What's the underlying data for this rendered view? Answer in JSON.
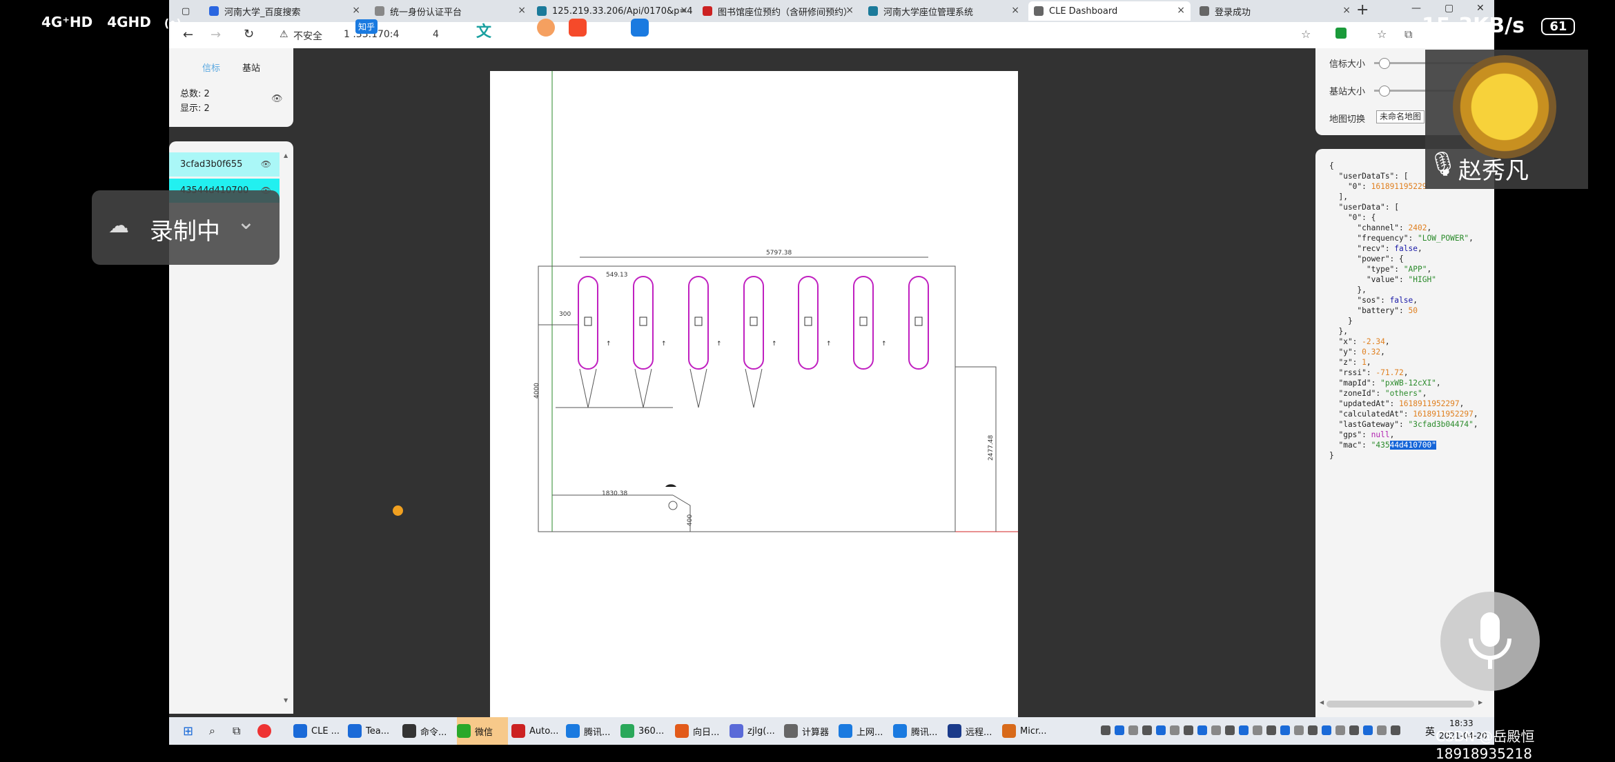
{
  "phone_status": {
    "signal1": "4G⁺HD",
    "signal2": "4GHD",
    "hotspot": "(•)",
    "net_speed": "15.3KB/s",
    "battery": "61"
  },
  "recording_overlay": {
    "label": "录制中",
    "chevron": "⌄"
  },
  "call": {
    "caller_name": "赵秀凡"
  },
  "watermark": "CSDN @岳殿恒18918935218",
  "browser": {
    "tabs": [
      {
        "label": "河南大学_百度搜索",
        "color": "#2a66e0"
      },
      {
        "label": "统一身份认证平台",
        "color": "#888"
      },
      {
        "label": "125.219.33.206/Api/0170&p=4",
        "color": "#1b7a9a"
      },
      {
        "label": "图书馆座位预约（含研修间预约）",
        "color": "#c22"
      },
      {
        "label": "河南大学座位管理系统",
        "color": "#1b7a9a"
      },
      {
        "label": "CLE Dashboard",
        "color": "#666"
      },
      {
        "label": "登录成功",
        "color": "#666"
      }
    ],
    "new_tab": "+",
    "window_controls": [
      "—",
      "▢",
      "✕"
    ],
    "address": {
      "security": "不安全",
      "url": "1 .33.170:4",
      "extra": "4"
    },
    "overlay_icons": [
      "知乎",
      "文"
    ]
  },
  "left_panel": {
    "tabs": [
      "信标",
      "基站"
    ],
    "total_label": "总数: 2",
    "shown_label": "显示: 2",
    "devices": [
      "3cfad3b0f655",
      "43544d410700"
    ]
  },
  "right_panel": {
    "beacon_size_label": "信标大小",
    "station_size_label": "基站大小",
    "map_switch_label": "地图切换",
    "map_select_value": "未命名地图"
  },
  "json_view": {
    "lines": [
      [
        [
          "jk",
          "{"
        ]
      ],
      [
        [
          "jk",
          "  \"userDataTs\": ["
        ]
      ],
      [
        [
          "jk",
          "    \"0\": "
        ],
        [
          "jn",
          "161891195229"
        ]
      ],
      [
        [
          "jk",
          "  ],"
        ]
      ],
      [
        [
          "jk",
          "  \"userData\": ["
        ]
      ],
      [
        [
          "jk",
          "    \"0\": {"
        ]
      ],
      [
        [
          "jk",
          "      \"channel\": "
        ],
        [
          "jn",
          "2402"
        ],
        [
          "jk",
          ","
        ]
      ],
      [
        [
          "jk",
          "      \"frequency\": "
        ],
        [
          "js",
          "\"LOW_POWER\""
        ],
        [
          "jk",
          ","
        ]
      ],
      [
        [
          "jk",
          "      \"recv\": "
        ],
        [
          "jb",
          "false"
        ],
        [
          "jk",
          ","
        ]
      ],
      [
        [
          "jk",
          "      \"power\": {"
        ]
      ],
      [
        [
          "jk",
          "        \"type\": "
        ],
        [
          "js",
          "\"APP\""
        ],
        [
          "jk",
          ","
        ]
      ],
      [
        [
          "jk",
          "        \"value\": "
        ],
        [
          "js",
          "\"HIGH\""
        ]
      ],
      [
        [
          "jk",
          "      },"
        ]
      ],
      [
        [
          "jk",
          "      \"sos\": "
        ],
        [
          "jb",
          "false"
        ],
        [
          "jk",
          ","
        ]
      ],
      [
        [
          "jk",
          "      \"battery\": "
        ],
        [
          "jn",
          "50"
        ]
      ],
      [
        [
          "jk",
          "    }"
        ]
      ],
      [
        [
          "jk",
          "  },"
        ]
      ],
      [
        [
          "jk",
          "  \"x\": "
        ],
        [
          "jn",
          "-2.34"
        ],
        [
          "jk",
          ","
        ]
      ],
      [
        [
          "jk",
          "  \"y\": "
        ],
        [
          "jn",
          "0.32"
        ],
        [
          "jk",
          ","
        ]
      ],
      [
        [
          "jk",
          "  \"z\": "
        ],
        [
          "jn",
          "1"
        ],
        [
          "jk",
          ","
        ]
      ],
      [
        [
          "jk",
          "  \"rssi\": "
        ],
        [
          "jn",
          "-71.72"
        ],
        [
          "jk",
          ","
        ]
      ],
      [
        [
          "jk",
          "  \"mapId\": "
        ],
        [
          "js",
          "\"pxWB-12cXI\""
        ],
        [
          "jk",
          ","
        ]
      ],
      [
        [
          "jk",
          "  \"zoneId\": "
        ],
        [
          "js",
          "\"others\""
        ],
        [
          "jk",
          ","
        ]
      ],
      [
        [
          "jk",
          "  \"updatedAt\": "
        ],
        [
          "jn",
          "1618911952297"
        ],
        [
          "jk",
          ","
        ]
      ],
      [
        [
          "jk",
          "  \"calculatedAt\": "
        ],
        [
          "jn",
          "1618911952297"
        ],
        [
          "jk",
          ","
        ]
      ],
      [
        [
          "jk",
          "  \"lastGateway\": "
        ],
        [
          "js",
          "\"3cfad3b04474\""
        ],
        [
          "jk",
          ","
        ]
      ],
      [
        [
          "jk",
          "  \"gps\": "
        ],
        [
          "jl",
          "null"
        ],
        [
          "jk",
          ","
        ]
      ],
      [
        [
          "jk",
          "  \"mac\": "
        ],
        [
          "js",
          "\"435"
        ],
        [
          "hl",
          "44d410700\""
        ]
      ],
      [
        [
          "jk",
          "}"
        ]
      ]
    ]
  },
  "floorplan": {
    "dims": [
      "5797.38",
      "549.13",
      "300",
      "4000",
      "1830.38",
      "2477.48",
      "400"
    ]
  },
  "taskbar": {
    "items": [
      "CLE ...",
      "Tea...",
      "命令...",
      "微信",
      "Auto...",
      "腾讯...",
      "360...",
      "向日...",
      "zjlg(...",
      "计算器",
      "上网...",
      "腾讯...",
      "远程...",
      "Micr..."
    ],
    "ime": "英",
    "time": "18:33",
    "date": "2021-04-20"
  }
}
